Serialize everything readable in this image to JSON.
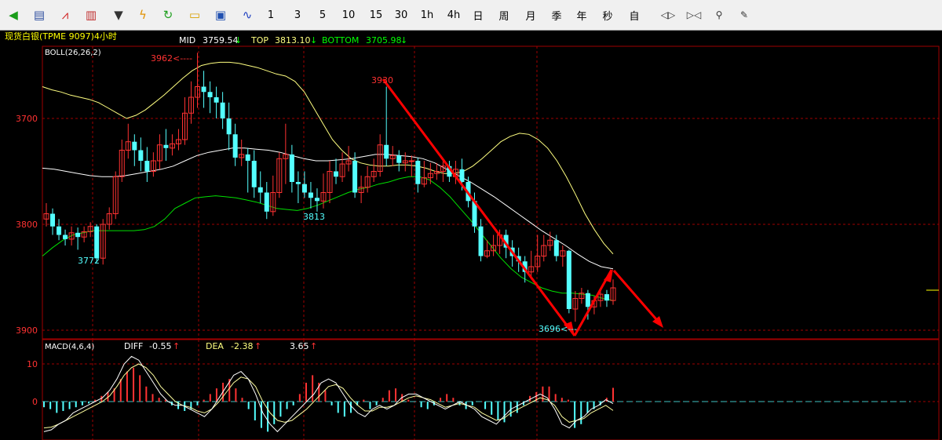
{
  "toolbar": {
    "icons": [
      "back-arrow-icon",
      "list-icon",
      "line-chart-icon",
      "bar-chart-icon",
      "dropdown-icon",
      "lightning-icon",
      "refresh-icon",
      "folder-open-icon",
      "save-icon",
      "trend-line-icon"
    ],
    "periods": [
      "1",
      "3",
      "5",
      "10",
      "15",
      "30",
      "1h",
      "4h",
      "日",
      "周",
      "月",
      "季",
      "年",
      "秒",
      "自"
    ],
    "tools": [
      "expand-horizontal-icon",
      "shrink-horizontal-icon",
      "search-icon",
      "pencil-icon"
    ]
  },
  "header": {
    "title": "现货白银(TPME 9097)4小时",
    "mid_label": "MID",
    "mid_value": "3759.54",
    "top_label": "TOP",
    "top_value": "3813.10",
    "bottom_label": "BOTTOM",
    "bottom_value": "3705.98",
    "arrow": "↓"
  },
  "main_panel": {
    "indicator": "BOLL(26,26,2)",
    "y_ticks": [
      "3900",
      "3800",
      "3700"
    ],
    "annotations": {
      "high1": "3962<----",
      "high2": "3930",
      "low1": "3772",
      "low2": "3813",
      "low3": "3696<---"
    }
  },
  "macd_panel": {
    "indicator": "MACD(4,6,4)",
    "diff_label": "DIFF",
    "diff_value": "-0.55",
    "dea_label": "DEA",
    "dea_value": "-2.38",
    "macd_value": "3.65",
    "arrow": "↑",
    "y_ticks": [
      "10",
      "0"
    ]
  },
  "colors": {
    "up": "#ff3232",
    "down": "#54ffff",
    "grid": "#a00000",
    "mid": "#ffffff",
    "upper": "#ffff80",
    "lower": "#00e000",
    "arrow": "#ff0000"
  },
  "chart_data": [
    {
      "type": "candlestick",
      "title": "现货白银(TPME 9097)4小时",
      "ylim": [
        3690,
        3990
      ],
      "y_ticks": [
        3700,
        3800,
        3900
      ],
      "candles": [
        [
          3805,
          3810,
          3820,
          3798
        ],
        [
          3810,
          3798,
          3815,
          3790
        ],
        [
          3798,
          3790,
          3805,
          3785
        ],
        [
          3790,
          3786,
          3795,
          3780
        ],
        [
          3786,
          3792,
          3798,
          3780
        ],
        [
          3792,
          3788,
          3797,
          3776
        ],
        [
          3788,
          3793,
          3798,
          3783
        ],
        [
          3793,
          3798,
          3802,
          3788
        ],
        [
          3798,
          3768,
          3800,
          3764
        ],
        [
          3768,
          3800,
          3805,
          3762
        ],
        [
          3800,
          3810,
          3816,
          3795
        ],
        [
          3810,
          3845,
          3850,
          3805
        ],
        [
          3845,
          3870,
          3880,
          3840
        ],
        [
          3870,
          3878,
          3895,
          3862
        ],
        [
          3878,
          3870,
          3885,
          3855
        ],
        [
          3870,
          3860,
          3882,
          3850
        ],
        [
          3860,
          3850,
          3873,
          3840
        ],
        [
          3850,
          3860,
          3868,
          3845
        ],
        [
          3860,
          3875,
          3885,
          3852
        ],
        [
          3875,
          3872,
          3890,
          3860
        ],
        [
          3872,
          3876,
          3885,
          3865
        ],
        [
          3876,
          3880,
          3890,
          3870
        ],
        [
          3880,
          3905,
          3920,
          3875
        ],
        [
          3905,
          3920,
          3935,
          3895
        ],
        [
          3920,
          3930,
          3962,
          3910
        ],
        [
          3930,
          3925,
          3945,
          3910
        ],
        [
          3925,
          3920,
          3935,
          3905
        ],
        [
          3920,
          3915,
          3930,
          3900
        ],
        [
          3915,
          3900,
          3925,
          3890
        ],
        [
          3900,
          3885,
          3915,
          3870
        ],
        [
          3885,
          3863,
          3895,
          3855
        ],
        [
          3863,
          3866,
          3880,
          3855
        ],
        [
          3866,
          3860,
          3872,
          3830
        ],
        [
          3860,
          3835,
          3870,
          3825
        ],
        [
          3835,
          3830,
          3850,
          3820
        ],
        [
          3830,
          3812,
          3840,
          3805
        ],
        [
          3812,
          3830,
          3846,
          3808
        ],
        [
          3830,
          3862,
          3868,
          3825
        ],
        [
          3862,
          3866,
          3895,
          3838
        ],
        [
          3866,
          3840,
          3875,
          3830
        ],
        [
          3840,
          3838,
          3850,
          3820
        ],
        [
          3838,
          3830,
          3850,
          3825
        ],
        [
          3830,
          3825,
          3840,
          3815
        ],
        [
          3825,
          3822,
          3834,
          3812
        ],
        [
          3822,
          3830,
          3848,
          3815
        ],
        [
          3830,
          3850,
          3860,
          3820
        ],
        [
          3850,
          3845,
          3862,
          3838
        ],
        [
          3845,
          3857,
          3868,
          3840
        ],
        [
          3857,
          3860,
          3874,
          3850
        ],
        [
          3860,
          3830,
          3868,
          3825
        ],
        [
          3830,
          3835,
          3846,
          3820
        ],
        [
          3835,
          3845,
          3855,
          3830
        ],
        [
          3845,
          3850,
          3862,
          3840
        ],
        [
          3850,
          3875,
          3885,
          3845
        ],
        [
          3875,
          3862,
          3930,
          3855
        ],
        [
          3862,
          3865,
          3874,
          3855
        ],
        [
          3865,
          3858,
          3870,
          3850
        ],
        [
          3858,
          3860,
          3868,
          3850
        ],
        [
          3860,
          3860,
          3865,
          3845
        ],
        [
          3860,
          3838,
          3863,
          3830
        ],
        [
          3838,
          3844,
          3860,
          3835
        ],
        [
          3844,
          3848,
          3858,
          3838
        ],
        [
          3848,
          3850,
          3858,
          3842
        ],
        [
          3850,
          3855,
          3862,
          3840
        ],
        [
          3855,
          3845,
          3860,
          3840
        ],
        [
          3845,
          3852,
          3860,
          3838
        ],
        [
          3852,
          3840,
          3862,
          3832
        ],
        [
          3840,
          3822,
          3845,
          3816
        ],
        [
          3822,
          3798,
          3830,
          3792
        ],
        [
          3798,
          3770,
          3805,
          3765
        ],
        [
          3770,
          3775,
          3785,
          3768
        ],
        [
          3775,
          3780,
          3790,
          3770
        ],
        [
          3780,
          3790,
          3795,
          3772
        ],
        [
          3790,
          3778,
          3795,
          3768
        ],
        [
          3778,
          3770,
          3785,
          3760
        ],
        [
          3770,
          3765,
          3778,
          3755
        ],
        [
          3765,
          3755,
          3770,
          3745
        ],
        [
          3755,
          3760,
          3775,
          3748
        ],
        [
          3760,
          3770,
          3790,
          3755
        ],
        [
          3770,
          3780,
          3790,
          3765
        ],
        [
          3780,
          3785,
          3793,
          3775
        ],
        [
          3785,
          3770,
          3790,
          3765
        ],
        [
          3770,
          3775,
          3780,
          3760
        ],
        [
          3775,
          3720,
          3776,
          3716
        ],
        [
          3720,
          3730,
          3737,
          3708
        ],
        [
          3730,
          3735,
          3740,
          3725
        ],
        [
          3735,
          3722,
          3738,
          3710
        ],
        [
          3722,
          3728,
          3732,
          3715
        ],
        [
          3728,
          3734,
          3738,
          3722
        ],
        [
          3734,
          3728,
          3738,
          3722
        ],
        [
          3728,
          3740,
          3748,
          3724
        ]
      ],
      "boll": {
        "upper": [
          3930,
          3927,
          3925,
          3922,
          3920,
          3918,
          3915,
          3910,
          3905,
          3900,
          3903,
          3908,
          3915,
          3922,
          3930,
          3938,
          3945,
          3950,
          3952,
          3953,
          3953,
          3952,
          3950,
          3948,
          3945,
          3942,
          3940,
          3935,
          3925,
          3910,
          3895,
          3880,
          3870,
          3862,
          3858,
          3856,
          3855,
          3855,
          3856,
          3856,
          3855,
          3853,
          3850,
          3848,
          3848,
          3850,
          3855,
          3862,
          3870,
          3878,
          3883,
          3886,
          3885,
          3880,
          3872,
          3860,
          3845,
          3828,
          3810,
          3795,
          3782,
          3772
        ],
        "mid": [
          3853,
          3852,
          3850,
          3848,
          3846,
          3845,
          3845,
          3846,
          3848,
          3850,
          3852,
          3855,
          3860,
          3865,
          3868,
          3870,
          3872,
          3872,
          3871,
          3870,
          3868,
          3865,
          3862,
          3860,
          3860,
          3861,
          3862,
          3864,
          3866,
          3866,
          3865,
          3864,
          3862,
          3858,
          3852,
          3846,
          3840,
          3833,
          3826,
          3818,
          3810,
          3802,
          3794,
          3787,
          3780,
          3772,
          3765,
          3760,
          3758
        ],
        "lower": [
          3770,
          3778,
          3785,
          3790,
          3792,
          3794,
          3794,
          3794,
          3794,
          3794,
          3795,
          3798,
          3805,
          3815,
          3820,
          3825,
          3826,
          3827,
          3826,
          3825,
          3823,
          3821,
          3818,
          3815,
          3814,
          3813,
          3815,
          3818,
          3822,
          3826,
          3830,
          3833,
          3835,
          3838,
          3840,
          3843,
          3845,
          3845,
          3842,
          3835,
          3826,
          3815,
          3804,
          3792,
          3780,
          3768,
          3758,
          3750,
          3745,
          3740,
          3737,
          3735,
          3735,
          3734,
          3733,
          3730,
          3728
        ],
        "mid_value": 3759.54,
        "top_value": 3813.1,
        "bottom_value": 3705.98
      },
      "annotations_values": {
        "3962": 3962,
        "3930": 3930,
        "3772": 3772,
        "3813": 3813,
        "3696": 3696
      }
    },
    {
      "type": "bar",
      "title": "MACD(4,6,4)",
      "ylim": [
        -8,
        14
      ],
      "y_ticks": [
        10,
        0
      ],
      "histogram": [
        -1.5,
        -2,
        -3,
        -2.5,
        -2,
        -1.5,
        -1,
        -0.5,
        0.5,
        1.5,
        2.5,
        3.5,
        6,
        8,
        9,
        7,
        4,
        2,
        1,
        0.5,
        -1,
        -2,
        -2.5,
        -2,
        -1,
        0.5,
        2,
        3.5,
        5,
        6,
        3.5,
        1,
        -2,
        -5,
        -7,
        -8,
        -6,
        -4,
        -2,
        -1,
        2,
        5,
        7,
        5,
        3,
        -1,
        -3,
        -4,
        -3,
        -1,
        0.5,
        -2,
        -1,
        1,
        3,
        3.5,
        2,
        0.5,
        0,
        -1.5,
        -2,
        -1,
        1,
        2,
        1,
        -1,
        -2,
        -1,
        0,
        -2,
        -3.5,
        -5,
        -5.5,
        -4,
        -3,
        -1,
        1.5,
        2.5,
        4,
        4,
        2,
        1,
        0.5,
        -7,
        -6,
        -3,
        -2,
        -1,
        1,
        3.65
      ],
      "diff": [
        -8,
        -7.5,
        -6,
        -5,
        -3,
        -2,
        -1,
        0,
        1,
        3,
        6,
        10,
        12,
        11,
        8,
        5,
        2,
        0,
        -1,
        -1,
        -2,
        -3,
        -4,
        -2,
        1,
        4,
        7,
        8,
        6,
        2,
        -3,
        -6,
        -8,
        -6,
        -4,
        -2,
        0,
        2,
        5,
        6,
        5,
        2,
        -1,
        -3,
        -4,
        -2,
        -1,
        -2,
        -1,
        1,
        2,
        2,
        1,
        0,
        -1,
        -2,
        -1,
        0,
        -1,
        -2,
        -4,
        -5,
        -6,
        -4,
        -2,
        -1,
        0,
        1,
        2,
        1,
        -2,
        -6,
        -7,
        -5,
        -4,
        -2,
        -1,
        0.5,
        -0.55
      ],
      "dea": [
        -7,
        -6.8,
        -6,
        -5,
        -4,
        -3,
        -2,
        -1,
        0,
        1.5,
        4,
        7,
        9,
        10,
        9,
        7,
        4,
        2,
        0,
        -1,
        -1.5,
        -2.5,
        -3,
        -2,
        0,
        2.5,
        5,
        6.5,
        6,
        4,
        0,
        -3,
        -5,
        -5.5,
        -5,
        -3.5,
        -2,
        0,
        2,
        4,
        4.5,
        3.5,
        1,
        -1,
        -2.5,
        -2.5,
        -1.5,
        -1.5,
        -1,
        0,
        1,
        1.5,
        1,
        0.5,
        -0.5,
        -1.5,
        -1,
        -0.5,
        -1,
        -1.5,
        -3,
        -4,
        -5,
        -4.5,
        -3,
        -2,
        -1,
        0,
        1,
        0.5,
        -1,
        -4,
        -5.5,
        -5,
        -4.5,
        -3,
        -2,
        -1,
        -2.38
      ]
    }
  ]
}
